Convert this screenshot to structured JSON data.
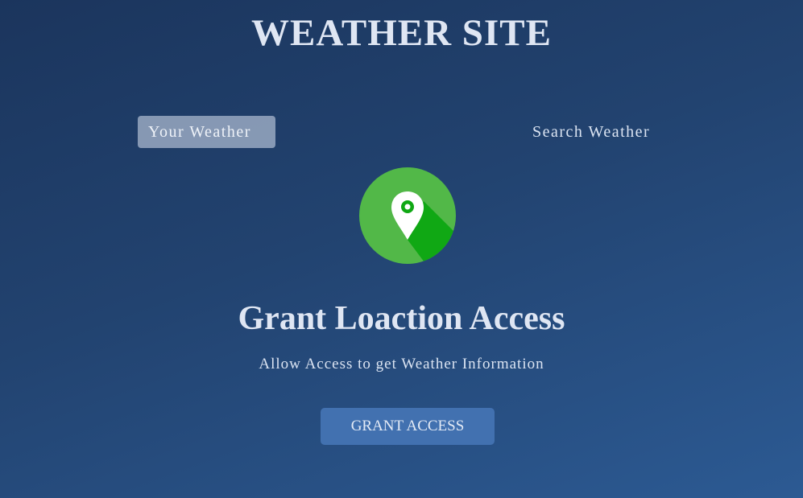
{
  "header": {
    "title": "WEATHER SITE"
  },
  "tabs": {
    "your_weather": "Your Weather",
    "search_weather": "Search Weather"
  },
  "grant": {
    "icon": "location-pin-icon",
    "heading": "Grant Loaction Access",
    "subtitle": "Allow Access to get Weather Information",
    "button_label": "GRANT ACCESS"
  },
  "colors": {
    "background_top": "#1b355d",
    "background_bottom": "#2c5a93",
    "icon_circle": "#52b848",
    "icon_shadow": "#10a814",
    "button": "#4271b0"
  }
}
